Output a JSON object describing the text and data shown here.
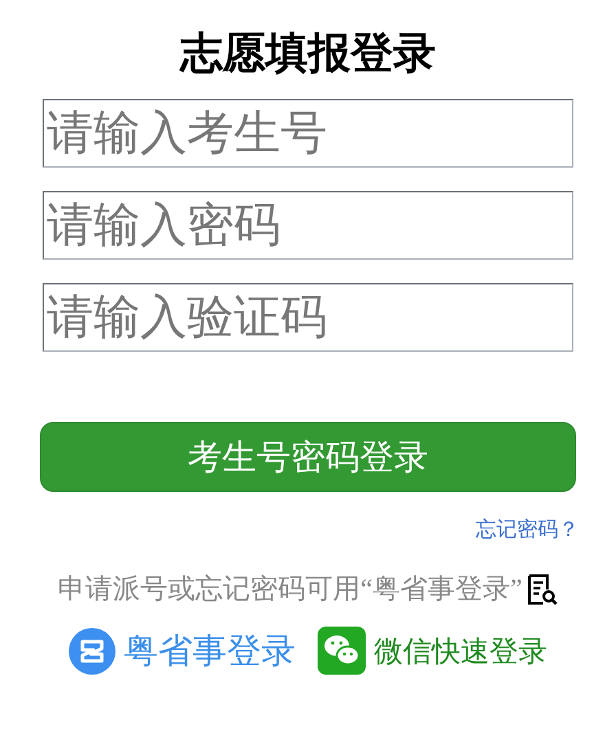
{
  "title": "志愿填报登录",
  "fields": [
    {
      "placeholder": "请输入考生号"
    },
    {
      "placeholder": "请输入密码"
    },
    {
      "placeholder": "请输入验证码"
    }
  ],
  "login_button": "考生号密码登录",
  "forgot_link": "忘记密码？",
  "note": "申请派号或忘记密码可用“粤省事登录”",
  "alt_logins": [
    {
      "kind": "yueshengshi",
      "label": "粤省事登录"
    },
    {
      "kind": "wechat",
      "label": "微信快速登录"
    }
  ]
}
